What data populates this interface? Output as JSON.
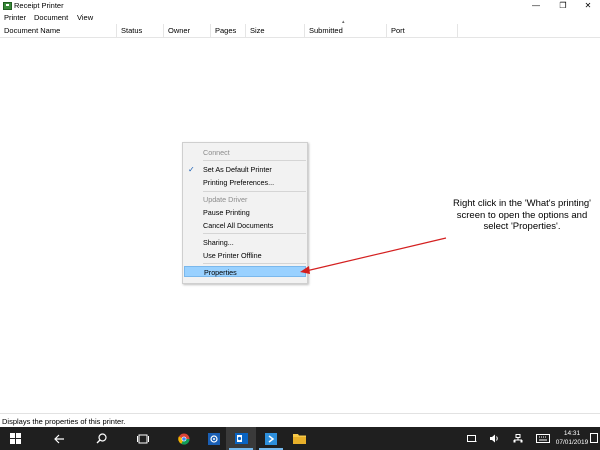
{
  "window": {
    "title": "Receipt Printer",
    "controls": {
      "minimize": "—",
      "maximize": "❐",
      "close": "✕"
    }
  },
  "menubar": [
    "Printer",
    "Document",
    "View"
  ],
  "columns": [
    "Document Name",
    "Status",
    "Owner",
    "Pages",
    "Size",
    "Submitted",
    "Port"
  ],
  "context_menu": {
    "items": [
      {
        "label": "Connect",
        "state": "disabled"
      },
      {
        "label": "Set As Default Printer",
        "checked": true
      },
      {
        "label": "Printing Preferences..."
      },
      {
        "label": "Update Driver",
        "state": "disabled"
      },
      {
        "label": "Pause Printing"
      },
      {
        "label": "Cancel All Documents"
      },
      {
        "label": "Sharing..."
      },
      {
        "label": "Use Printer Offline"
      },
      {
        "label": "Properties",
        "state": "selected"
      }
    ]
  },
  "annotation": "Right click in the 'What's printing' screen to open the options and select 'Properties'.",
  "status_bar": "Displays the properties of this printer.",
  "taskbar": {
    "clock_time": "14:31",
    "clock_date": "07/01/2019",
    "icons": [
      "windows-start-icon",
      "back-arrow-icon",
      "search-icon",
      "task-view-icon",
      "chrome-icon",
      "settings-icon",
      "outlook-icon",
      "remote-desktop-icon",
      "file-explorer-icon"
    ]
  },
  "colors": {
    "taskbar": "#1f1f1f",
    "selection": "#99d1ff",
    "arrow": "#d42020",
    "accent": "#76b9ed"
  }
}
